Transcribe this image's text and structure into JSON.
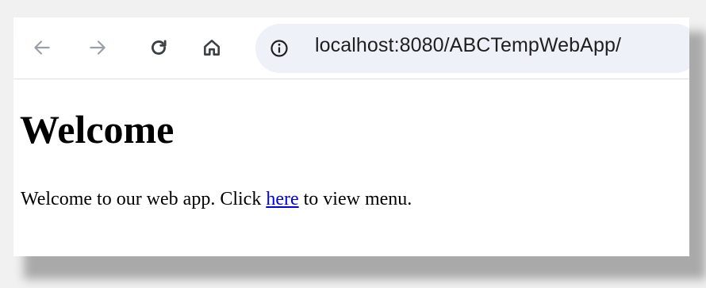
{
  "browser": {
    "toolbar": {
      "back_icon": "arrow-left-icon",
      "forward_icon": "arrow-right-icon",
      "reload_icon": "reload-icon",
      "home_icon": "home-icon"
    },
    "omnibox": {
      "info_icon": "info-icon",
      "url": "localhost:8080/ABCTempWebApp/"
    }
  },
  "page": {
    "heading": "Welcome",
    "paragraph_before": "Welcome to our web app. Click ",
    "link_text": "here",
    "paragraph_after": " to view menu."
  },
  "colors": {
    "link": "#0000ee",
    "omnibox_bg": "#eef1f8",
    "disabled_icon": "#9aa0a6"
  }
}
